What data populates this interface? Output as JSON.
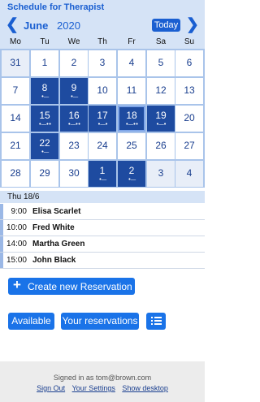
{
  "app": {
    "title": "Schedule for Therapist"
  },
  "nav": {
    "prev_glyph": "❮",
    "next_glyph": "❯",
    "month": "June",
    "year": "2020",
    "today_label": "Today"
  },
  "weekdays": [
    "Mo",
    "Tu",
    "We",
    "Th",
    "Fr",
    "Sa",
    "Su"
  ],
  "calendar": {
    "weeks": [
      [
        {
          "day": "31",
          "other": true
        },
        {
          "day": "1"
        },
        {
          "day": "2"
        },
        {
          "day": "3"
        },
        {
          "day": "4"
        },
        {
          "day": "5"
        },
        {
          "day": "6"
        }
      ],
      [
        {
          "day": "7"
        },
        {
          "day": "8",
          "booked": true,
          "marks": 1
        },
        {
          "day": "9",
          "booked": true,
          "marks": 1
        },
        {
          "day": "10"
        },
        {
          "day": "11"
        },
        {
          "day": "12"
        },
        {
          "day": "13"
        }
      ],
      [
        {
          "day": "14"
        },
        {
          "day": "15",
          "booked": true,
          "marks": 3
        },
        {
          "day": "16",
          "booked": true,
          "marks": 3
        },
        {
          "day": "17",
          "booked": true,
          "marks": 2
        },
        {
          "day": "18",
          "booked": true,
          "marks": 3,
          "selected": true
        },
        {
          "day": "19",
          "booked": true,
          "marks": 2
        },
        {
          "day": "20"
        }
      ],
      [
        {
          "day": "21"
        },
        {
          "day": "22",
          "booked": true,
          "marks": 1
        },
        {
          "day": "23"
        },
        {
          "day": "24"
        },
        {
          "day": "25"
        },
        {
          "day": "26"
        },
        {
          "day": "27"
        }
      ],
      [
        {
          "day": "28"
        },
        {
          "day": "29"
        },
        {
          "day": "30"
        },
        {
          "day": "1",
          "other": true,
          "booked": true,
          "marks": 1
        },
        {
          "day": "2",
          "other": true,
          "booked": true,
          "marks": 1
        },
        {
          "day": "3",
          "other": true
        },
        {
          "day": "4",
          "other": true
        }
      ]
    ]
  },
  "selected_day": {
    "label": "Thu 18/6"
  },
  "appointments": [
    {
      "time": "9:00",
      "name": "Elisa Scarlet"
    },
    {
      "time": "10:00",
      "name": "Fred White"
    },
    {
      "time": "14:00",
      "name": "Martha Green"
    },
    {
      "time": "15:00",
      "name": "John Black"
    }
  ],
  "actions": {
    "create_icon": "+",
    "create_label": "Create new Reservation",
    "available_label": "Available",
    "yours_label": "Your reservations",
    "list_icon": "list-icon"
  },
  "footer": {
    "signed_in": "Signed in as tom@brown.com",
    "links": [
      "Sign Out",
      "Your Settings",
      "Show desktop"
    ]
  },
  "colors": {
    "accent": "#1a73e8",
    "booked": "#1e4ba0",
    "header_bg": "#d5e3f6"
  }
}
